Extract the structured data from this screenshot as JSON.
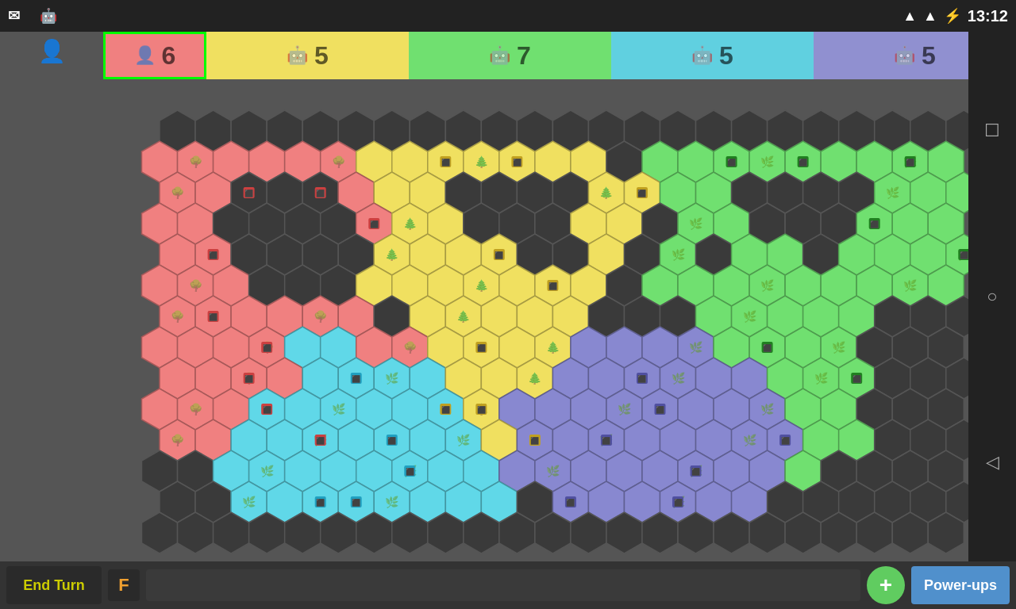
{
  "statusBar": {
    "time": "13:12",
    "wifiIcon": "wifi",
    "signalIcon": "signal",
    "batteryIcon": "battery"
  },
  "scores": [
    {
      "id": "current",
      "color": "red",
      "icon": "👤",
      "count": "6",
      "active": true
    },
    {
      "id": "p2",
      "color": "yellow",
      "icon": "🤖",
      "count": "5",
      "active": false
    },
    {
      "id": "p3",
      "color": "green",
      "icon": "🤖",
      "count": "7",
      "active": false
    },
    {
      "id": "p4",
      "color": "cyan",
      "icon": "🤖",
      "count": "5",
      "active": false
    },
    {
      "id": "p5",
      "color": "purple",
      "icon": "🤖",
      "count": "5",
      "active": false
    }
  ],
  "bottomBar": {
    "endTurnLabel": "End Turn",
    "fBadge": "F",
    "plusLabel": "+",
    "powerupsLabel": "Power-ups"
  },
  "board": {
    "cols": 28,
    "rows": 14,
    "hexSize": 30
  }
}
